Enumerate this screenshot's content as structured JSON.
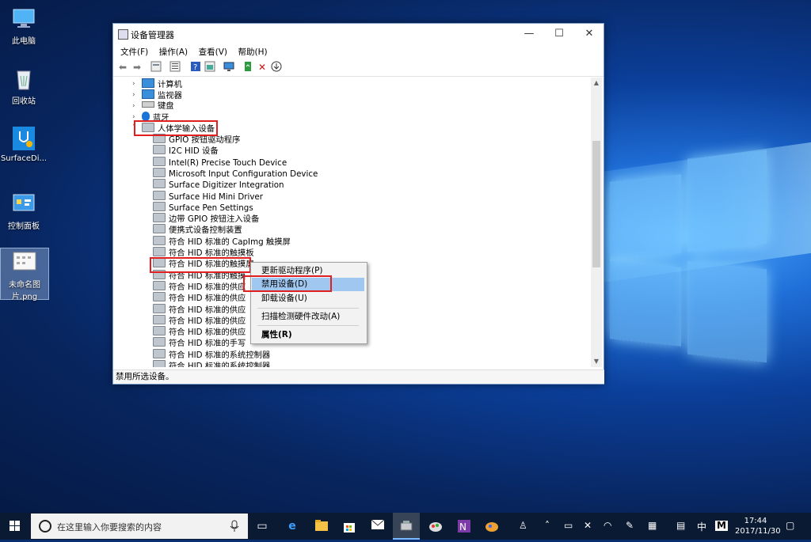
{
  "desktop": {
    "icons": [
      {
        "label": "此电脑",
        "icon": "computer-icon"
      },
      {
        "label": "回收站",
        "icon": "recycle-bin-icon"
      },
      {
        "label": "SurfaceDi...",
        "icon": "surface-diagnostic-icon"
      },
      {
        "label": "控制面板",
        "icon": "control-panel-icon"
      },
      {
        "label": "未命名图片.png",
        "icon": "image-file-icon"
      }
    ]
  },
  "window": {
    "title": "设备管理器",
    "controls": {
      "minimize": "—",
      "maximize": "☐",
      "close": "✕"
    },
    "menu": [
      "文件(F)",
      "操作(A)",
      "查看(V)",
      "帮助(H)"
    ],
    "tree": {
      "categories_top": [
        "计算机",
        "监视器",
        "键盘",
        "蓝牙"
      ],
      "expanded_category": "人体学输入设备",
      "children": [
        "GPIO 按钮驱动程序",
        "I2C HID 设备",
        "Intel(R) Precise Touch Device",
        "Microsoft Input Configuration Device",
        "Surface Digitizer Integration",
        "Surface Hid Mini Driver",
        "Surface Pen Settings",
        "边带 GPIO 按钮注入设备",
        "便携式设备控制装置",
        "符合 HID 标准的 CapImg 触摸屏",
        "符合 HID 标准的触摸板",
        "符合 HID 标准的触摸屏",
        "符合 HID 标准的触摸屏",
        "符合 HID 标准的供应商定义设备",
        "符合 HID 标准的供应商定义设备",
        "符合 HID 标准的供应商定义设备",
        "符合 HID 标准的供应商定义设备",
        "符合 HID 标准的供应商定义设备",
        "符合 HID 标准的手写笔",
        "符合 HID 标准的系统控制器",
        "符合 HID 标准的系统控制器"
      ],
      "child_visible_text": [
        "GPIO 按钮驱动程序",
        "I2C HID 设备",
        "Intel(R) Precise Touch Device",
        "Microsoft Input Configuration Device",
        "Surface Digitizer Integration",
        "Surface Hid Mini Driver",
        "Surface Pen Settings",
        "边带 GPIO 按钮注入设备",
        "便携式设备控制装置",
        "符合 HID 标准的 CapImg 触摸屏",
        "符合 HID 标准的触摸板",
        "符合 HID 标准的触摸屏",
        "符合 HID 标准的触摸",
        "符合 HID 标准的供应",
        "符合 HID 标准的供应",
        "符合 HID 标准的供应",
        "符合 HID 标准的供应",
        "符合 HID 标准的供应",
        "符合 HID 标准的手写",
        "符合 HID 标准的系统控制器",
        "符合 HID 标准的系统控制器"
      ]
    },
    "context_menu": {
      "items": [
        "更新驱动程序(P)",
        "禁用设备(D)",
        "卸载设备(U)",
        "扫描检测硬件改动(A)",
        "属性(R)"
      ],
      "highlighted": "禁用设备(D)"
    },
    "status": "禁用所选设备。"
  },
  "taskbar": {
    "search_placeholder": "在这里输入你要搜索的内容",
    "ime": "中",
    "ime_mode": "M",
    "time": "17:44",
    "date": "2017/11/30"
  },
  "colors": {
    "highlight_box": "#e02020",
    "menu_highlight": "#9fc7f0",
    "taskbar": "#0b1a33"
  }
}
